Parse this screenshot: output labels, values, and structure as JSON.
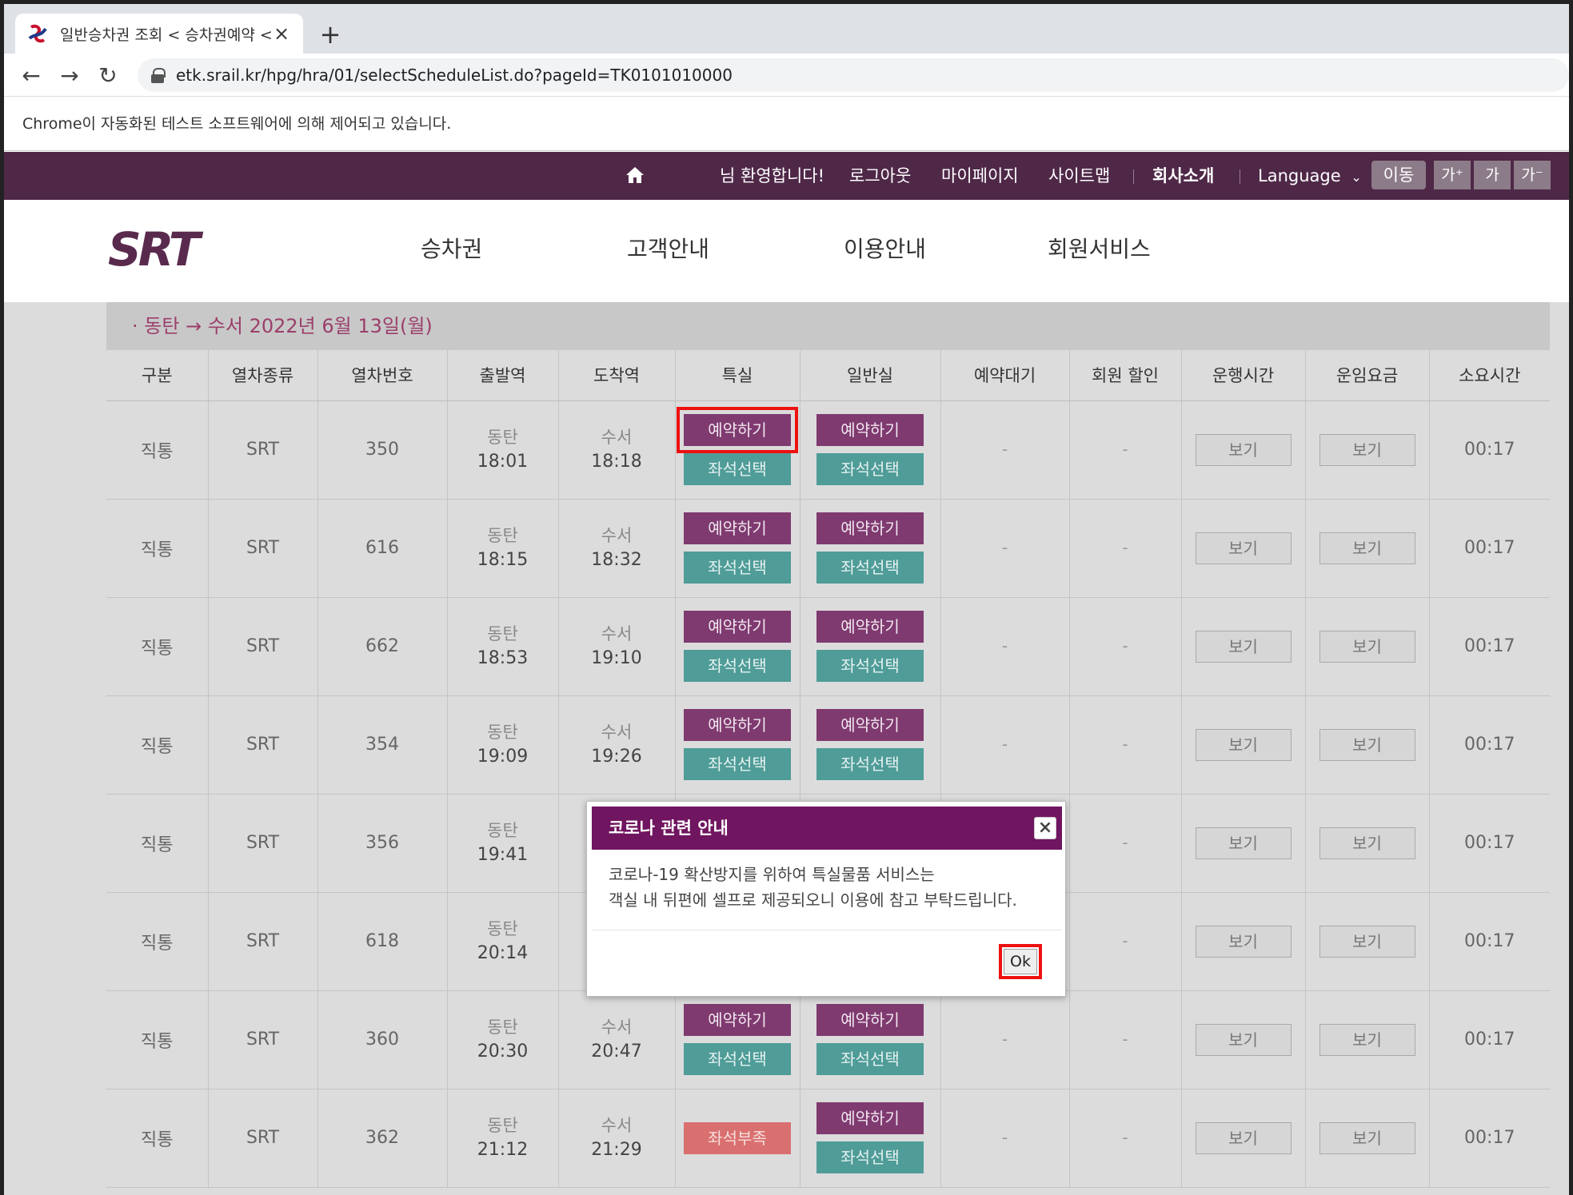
{
  "browser": {
    "tab_title": "일반승차권 조회 < 승차권예약 <",
    "url": "etk.srail.kr/hpg/hra/01/selectScheduleList.do?pageId=TK0101010000",
    "automation_notice": "Chrome이 자동화된 테스트 소프트웨어에 의해 제어되고 있습니다."
  },
  "topnav": {
    "welcome": "님 환영합니다!",
    "logout": "로그아웃",
    "mypage": "마이페이지",
    "sitemap": "사이트맵",
    "company": "회사소개",
    "language": "Language",
    "move": "이동",
    "font_up": "가⁺",
    "font_normal": "가",
    "font_down": "가⁻"
  },
  "mainnav": {
    "items": [
      "승차권",
      "고객안내",
      "이용안내",
      "회원서비스"
    ]
  },
  "route": "· 동탄 → 수서   2022년 6월 13일(월)",
  "table": {
    "headers": [
      "구분",
      "열차종류",
      "열차번호",
      "출발역",
      "도착역",
      "특실",
      "일반실",
      "예약대기",
      "회원 할인",
      "운행시간",
      "운임요금",
      "소요시간"
    ],
    "reserve_label": "예약하기",
    "seat_label": "좌석선택",
    "soldout_label": "좌석부족",
    "view_label": "보기",
    "dash": "-",
    "rows": [
      {
        "type": "직통",
        "kind": "SRT",
        "no": "350",
        "dep": "동탄",
        "dep_time": "18:01",
        "arr": "수서",
        "arr_time": "18:18",
        "duration": "00:17"
      },
      {
        "type": "직통",
        "kind": "SRT",
        "no": "616",
        "dep": "동탄",
        "dep_time": "18:15",
        "arr": "수서",
        "arr_time": "18:32",
        "duration": "00:17"
      },
      {
        "type": "직통",
        "kind": "SRT",
        "no": "662",
        "dep": "동탄",
        "dep_time": "18:53",
        "arr": "수서",
        "arr_time": "19:10",
        "duration": "00:17"
      },
      {
        "type": "직통",
        "kind": "SRT",
        "no": "354",
        "dep": "동탄",
        "dep_time": "19:09",
        "arr": "수서",
        "arr_time": "19:26",
        "duration": "00:17"
      },
      {
        "type": "직통",
        "kind": "SRT",
        "no": "356",
        "dep": "동탄",
        "dep_time": "19:41",
        "arr": "",
        "arr_time": "",
        "duration": "00:17"
      },
      {
        "type": "직통",
        "kind": "SRT",
        "no": "618",
        "dep": "동탄",
        "dep_time": "20:14",
        "arr": "",
        "arr_time": "",
        "duration": "00:17"
      },
      {
        "type": "직통",
        "kind": "SRT",
        "no": "360",
        "dep": "동탄",
        "dep_time": "20:30",
        "arr": "수서",
        "arr_time": "20:47",
        "duration": "00:17"
      },
      {
        "type": "직통",
        "kind": "SRT",
        "no": "362",
        "dep": "동탄",
        "dep_time": "21:12",
        "arr": "수서",
        "arr_time": "21:29",
        "duration": "00:17"
      }
    ]
  },
  "modal": {
    "title": "코로나 관련 안내",
    "close": "×",
    "line1": "코로나-19 확산방지를 위하여 특실물품 서비스는",
    "line2": "객실 내 뒤편에 셀프로 제공되오니 이용에 참고 부탁드립니다.",
    "ok": "Ok"
  },
  "colors": {
    "topnav_bg": "#4f2848",
    "reserve_btn": "#7f3a70",
    "seat_btn": "#4f9c98",
    "soldout_btn": "#d9706f",
    "modal_header": "#701560",
    "highlight": "#ee1111"
  },
  "icons": [
    "srt-favicon",
    "close-icon",
    "new-tab-icon",
    "back-icon",
    "forward-icon",
    "reload-icon",
    "lock-icon",
    "home-icon",
    "chevron-down-icon",
    "srt-logo"
  ]
}
